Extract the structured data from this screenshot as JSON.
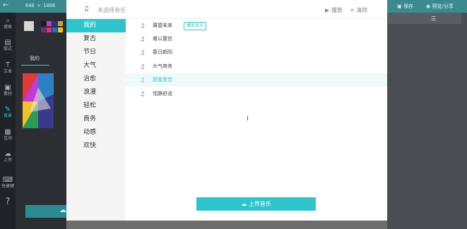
{
  "topbar": {
    "canvas_size": "640 × 1008",
    "save_label": "保存",
    "preview_label": "预览/分享"
  },
  "leftbar": {
    "items": [
      {
        "icon": "search-icon",
        "label": "搜索"
      },
      {
        "icon": "template-icon",
        "label": "版式"
      },
      {
        "icon": "text-icon",
        "label": "文本"
      },
      {
        "icon": "image-icon",
        "label": "素材"
      },
      {
        "icon": "background-icon",
        "label": "背景"
      },
      {
        "icon": "grid-icon",
        "label": "互动"
      },
      {
        "icon": "cloud-icon",
        "label": "上传"
      },
      {
        "icon": "keyboard-icon",
        "label": "快捷键"
      },
      {
        "icon": "help-icon",
        "label": ""
      }
    ]
  },
  "panel": {
    "tab_label": "我的",
    "colors": [
      "#1b1b1b",
      "#c23bd0",
      "#2e3192",
      "#c8a33c",
      "#6c2b86",
      "#d72f7c",
      "#1d6fbf",
      "#e6c52a"
    ]
  },
  "modal": {
    "current_song_placeholder": "未选择音乐",
    "play_label": "播放",
    "clear_label": "清除",
    "categories": [
      "我的",
      "复古",
      "节日",
      "大气",
      "治愈",
      "浪漫",
      "轻松",
      "商务",
      "动感",
      "欢快"
    ],
    "active_category": "我的",
    "songs": [
      {
        "title": "展望未来",
        "badge": "播放音乐"
      },
      {
        "title": "难以置信",
        "badge": ""
      },
      {
        "title": "春日颜阳",
        "badge": ""
      },
      {
        "title": "大气商务",
        "badge": ""
      },
      {
        "title": "甜蜜爱恋",
        "badge": ""
      },
      {
        "title": "恬静舒适",
        "badge": ""
      }
    ],
    "upload_label": "上传音乐"
  },
  "accent_color": "#2fc3cc"
}
